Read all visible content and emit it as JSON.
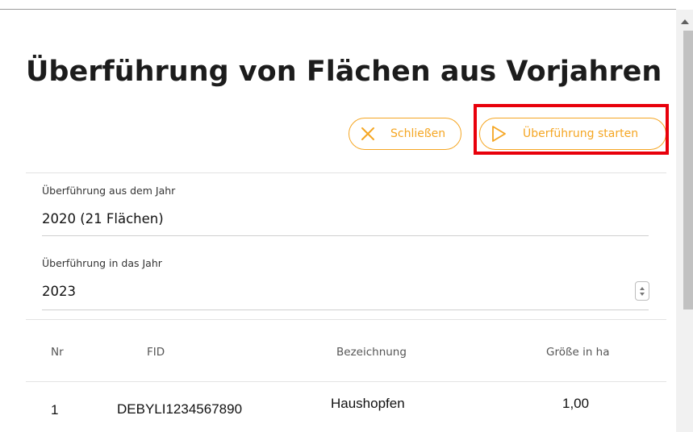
{
  "page_title": "Überführung von Flächen aus Vorjahren",
  "actions": {
    "close_label": "Schließen",
    "start_label": "Überführung starten"
  },
  "form": {
    "from_year": {
      "label": "Überführung aus dem Jahr",
      "value": "2020 (21 Flächen)"
    },
    "to_year": {
      "label": "Überführung in das Jahr",
      "value": "2023"
    }
  },
  "table": {
    "headers": {
      "nr": "Nr",
      "fid": "FID",
      "name": "Bezeichnung",
      "size": "Größe in ha"
    },
    "rows": [
      {
        "nr": "1",
        "fid": "DEBYLI1234567890",
        "name": "Haushopfen",
        "size": "1,00"
      }
    ]
  },
  "colors": {
    "accent": "#f5a623",
    "highlight": "#e8000b"
  },
  "icons": {
    "close": "close-x-icon",
    "start": "play-triangle-icon"
  }
}
